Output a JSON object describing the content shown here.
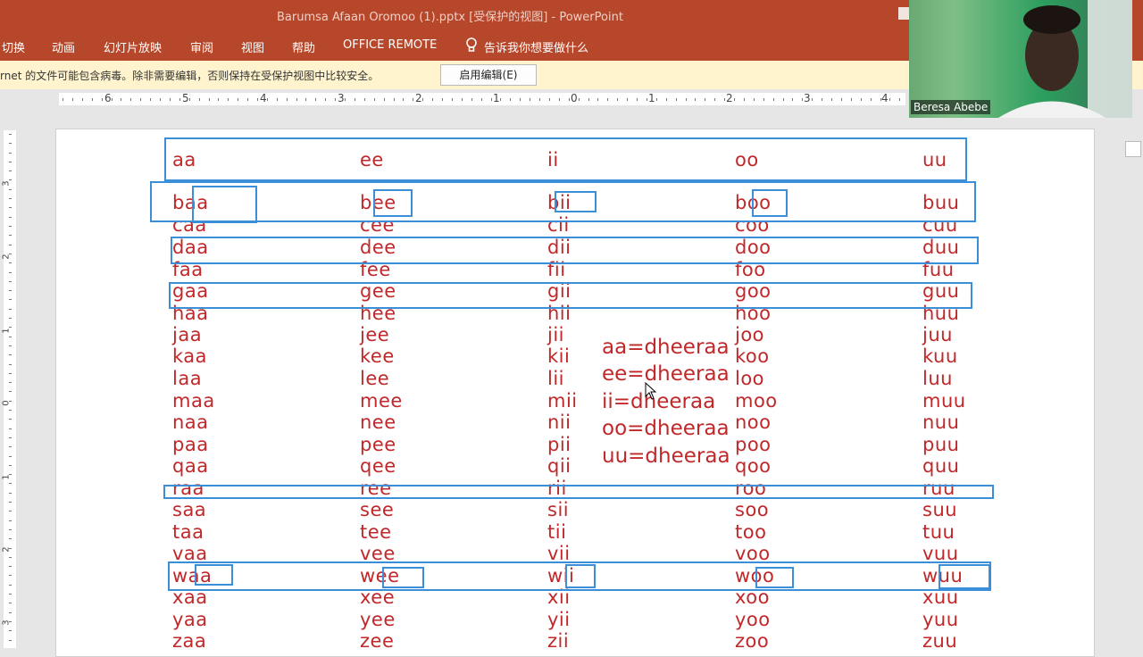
{
  "window": {
    "title": "Barumsa Afaan Oromoo (1).pptx [受保护的视图]  -  PowerPoint"
  },
  "ribbon": {
    "tabs": [
      "切换",
      "动画",
      "幻灯片放映",
      "审阅",
      "视图",
      "帮助",
      "OFFICE REMOTE"
    ],
    "tell_me": "告诉我你想要做什么"
  },
  "protected_view": {
    "message": "rnet 的文件可能包含病毒。除非需要编辑，否则保持在受保护视图中比较安全。",
    "enable_button": "启用编辑(E)"
  },
  "ruler": {
    "horizontal_numbers": [
      "6",
      "5",
      "4",
      "3",
      "2",
      "1",
      "0",
      "1",
      "2",
      "3",
      "4"
    ],
    "vertical_numbers": [
      "3",
      "2",
      "1",
      "0",
      "1",
      "2",
      "3"
    ]
  },
  "slide": {
    "rows": [
      [
        "aa",
        "ee",
        "ii",
        "oo",
        "uu"
      ],
      [
        "baa",
        "bee",
        "bii",
        "boo",
        "buu"
      ],
      [
        "caa",
        "cee",
        "cii",
        "coo",
        "cuu"
      ],
      [
        "daa",
        "dee",
        "dii",
        "doo",
        "duu"
      ],
      [
        "faa",
        "fee",
        "fii",
        "foo",
        "fuu"
      ],
      [
        "gaa",
        "gee",
        "gii",
        "goo",
        "guu"
      ],
      [
        "haa",
        "hee",
        "hii",
        "hoo",
        "huu"
      ],
      [
        "jaa",
        "jee",
        "jii",
        "joo",
        "juu"
      ],
      [
        "kaa",
        "kee",
        "kii",
        "koo",
        "kuu"
      ],
      [
        "laa",
        "lee",
        "lii",
        "loo",
        "luu"
      ],
      [
        "maa",
        "mee",
        "mii",
        "moo",
        "muu"
      ],
      [
        "naa",
        "nee",
        "nii",
        "noo",
        "nuu"
      ],
      [
        "paa",
        "pee",
        "pii",
        "poo",
        "puu"
      ],
      [
        "qaa",
        "qee",
        "qii",
        "qoo",
        "quu"
      ],
      [
        "raa",
        "ree",
        "rii",
        "roo",
        "ruu"
      ],
      [
        "saa",
        "see",
        "sii",
        "soo",
        "suu"
      ],
      [
        "taa",
        "tee",
        "tii",
        "too",
        "tuu"
      ],
      [
        "vaa",
        "vee",
        "vii",
        "voo",
        "vuu"
      ],
      [
        "waa",
        "wee",
        "wii",
        "woo",
        "wuu"
      ],
      [
        "xaa",
        "xee",
        "xii",
        "xoo",
        "xuu"
      ],
      [
        "yaa",
        "yee",
        "yii",
        "yoo",
        "yuu"
      ],
      [
        "zaa",
        "zee",
        "zii",
        "zoo",
        "zuu"
      ]
    ],
    "notes": [
      "aa=dheeraa",
      "ee=dheeraa",
      "ii=dheeraa",
      "oo=dheeraa",
      "uu=dheeraa"
    ]
  },
  "webcam": {
    "name": "Beresa Abebe"
  },
  "colors": {
    "ribbon": "#b7472a",
    "text_red": "#c0282a",
    "annotation_blue": "#3a8fd8",
    "protected_bar": "#fff4ce"
  }
}
